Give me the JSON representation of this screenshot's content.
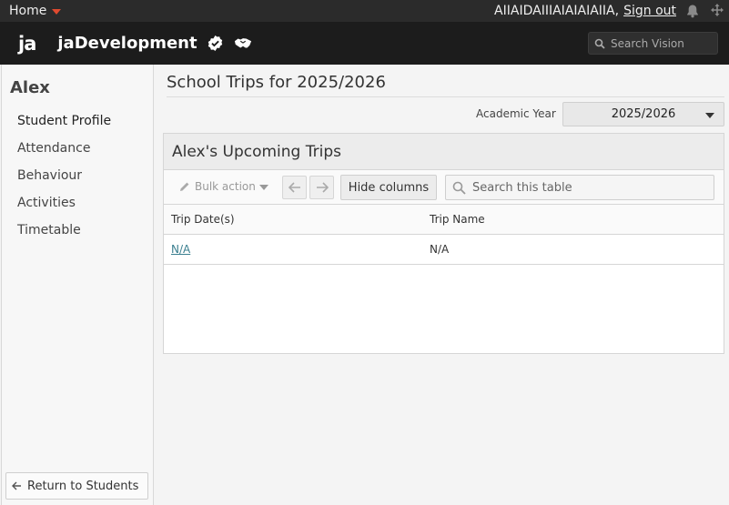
{
  "topbar": {
    "home_label": "Home",
    "user_name": "AIIAIDAIIIAIAIAIAIIA,",
    "sign_out_label": "Sign out",
    "icons": [
      "bell-icon",
      "move-arrows-icon"
    ],
    "caret_color": "#e04a2f"
  },
  "header": {
    "logo_text": "ja",
    "app_name": "jaDevelopment",
    "icons": [
      "verified-badge-icon",
      "handshake-icon"
    ],
    "search_placeholder": "Search Vision"
  },
  "sidebar": {
    "student_name": "Alex",
    "items": [
      {
        "label": "Student Profile"
      },
      {
        "label": "Attendance"
      },
      {
        "label": "Behaviour"
      },
      {
        "label": "Activities"
      },
      {
        "label": "Timetable"
      }
    ],
    "return_label": "Return to Students"
  },
  "main": {
    "page_title": "School Trips for 2025/2026",
    "academic_year_label": "Academic Year",
    "academic_year_value": "2025/2026",
    "panel_title": "Alex's Upcoming Trips",
    "toolbar": {
      "bulk_action_label": "Bulk action",
      "hide_columns_label": "Hide columns",
      "search_placeholder": "Search this table"
    },
    "table": {
      "columns": [
        "Trip Date(s)",
        "Trip Name"
      ],
      "rows": [
        {
          "trip_dates": "N/A",
          "trip_name": "N/A"
        }
      ]
    }
  }
}
